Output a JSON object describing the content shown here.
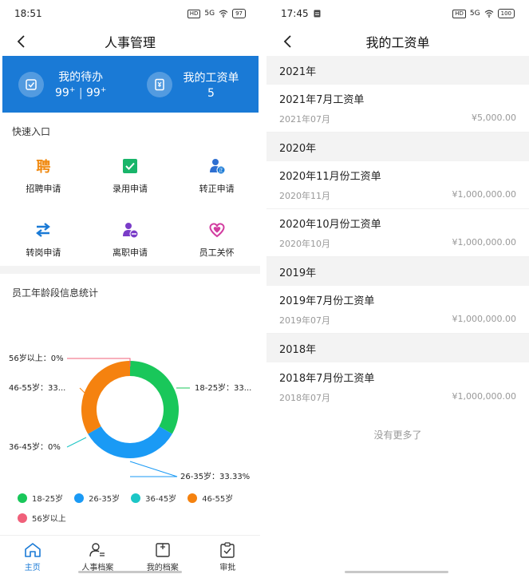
{
  "left": {
    "status": {
      "time": "18:51",
      "hd": "HD",
      "signal": "5G",
      "battery": "97"
    },
    "nav": {
      "title": "人事管理"
    },
    "banner": {
      "todo": {
        "label": "我的待办",
        "v1": "99",
        "v2": "99",
        "sup": "+",
        "sep": "|"
      },
      "payslip": {
        "label": "我的工资单",
        "value": "5"
      }
    },
    "quick": {
      "title": "快速入口",
      "items": [
        {
          "label": "招聘申请",
          "icon": "recruit-icon",
          "glyph": "聘"
        },
        {
          "label": "录用申请",
          "icon": "hire-check-icon"
        },
        {
          "label": "转正申请",
          "icon": "regularize-user-icon"
        },
        {
          "label": "转岗申请",
          "icon": "transfer-arrows-icon"
        },
        {
          "label": "离职申请",
          "icon": "resign-user-icon"
        },
        {
          "label": "员工关怀",
          "icon": "heart-care-icon"
        }
      ]
    },
    "stats": {
      "title": "员工年龄段信息统计"
    },
    "chart_data": {
      "type": "pie",
      "categories": [
        "18-25岁",
        "26-35岁",
        "36-45岁",
        "46-55岁",
        "56岁以上"
      ],
      "values": [
        33.33,
        33.33,
        0,
        33.33,
        0
      ],
      "labels": [
        "18-25岁：33...",
        "26-35岁：33.33%",
        "36-45岁：0%",
        "46-55岁：33...",
        "56岁以上：0%"
      ],
      "colors": [
        "#19c75a",
        "#1a9af5",
        "#1cc6c6",
        "#f5820f",
        "#f0607a"
      ],
      "donut": true,
      "legend_position": "bottom"
    },
    "tabs": [
      {
        "label": "主页",
        "icon": "home-icon",
        "active": true
      },
      {
        "label": "人事档案",
        "icon": "personnel-file-icon"
      },
      {
        "label": "我的档案",
        "icon": "my-file-icon"
      },
      {
        "label": "审批",
        "icon": "approval-icon"
      }
    ]
  },
  "right": {
    "status": {
      "time": "17:45",
      "hd": "HD",
      "signal": "5G",
      "battery": "100"
    },
    "nav": {
      "title": "我的工资单"
    },
    "groups": [
      {
        "year": "2021年",
        "items": [
          {
            "title": "2021年7月工资单",
            "date": "2021年07月",
            "amount": "¥5,000.00"
          }
        ]
      },
      {
        "year": "2020年",
        "items": [
          {
            "title": "2020年11月份工资单",
            "date": "2020年11月",
            "amount": "¥1,000,000.00"
          },
          {
            "title": "2020年10月份工资单",
            "date": "2020年10月",
            "amount": "¥1,000,000.00"
          }
        ]
      },
      {
        "year": "2019年",
        "items": [
          {
            "title": "2019年7月份工资单",
            "date": "2019年07月",
            "amount": "¥1,000,000.00"
          }
        ]
      },
      {
        "year": "2018年",
        "items": [
          {
            "title": "2018年7月份工资单",
            "date": "2018年07月",
            "amount": "¥1,000,000.00"
          }
        ]
      }
    ],
    "no_more": "没有更多了"
  }
}
